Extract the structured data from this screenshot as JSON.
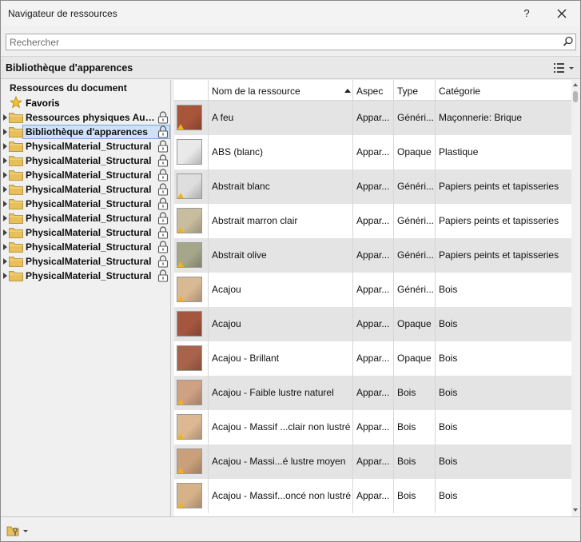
{
  "window": {
    "title": "Navigateur de ressources",
    "help_label": "?"
  },
  "search": {
    "placeholder": "Rechercher",
    "value": ""
  },
  "library_bar": {
    "title": "Bibliothèque d'apparences"
  },
  "tree": {
    "header": "Ressources du document",
    "favorites": "Favoris",
    "items": [
      {
        "label": "Ressources physiques Autodesk",
        "selected": false
      },
      {
        "label": "Bibliothèque d'apparences",
        "selected": true
      },
      {
        "label": "PhysicalMaterial_Structural",
        "selected": false
      },
      {
        "label": "PhysicalMaterial_Structural",
        "selected": false
      },
      {
        "label": "PhysicalMaterial_Structural",
        "selected": false
      },
      {
        "label": "PhysicalMaterial_Structural",
        "selected": false
      },
      {
        "label": "PhysicalMaterial_Structural",
        "selected": false
      },
      {
        "label": "PhysicalMaterial_Structural",
        "selected": false
      },
      {
        "label": "PhysicalMaterial_Structural",
        "selected": false
      },
      {
        "label": "PhysicalMaterial_Structural",
        "selected": false
      },
      {
        "label": "PhysicalMaterial_Structural",
        "selected": false
      },
      {
        "label": "PhysicalMaterial_Structural",
        "selected": false
      }
    ]
  },
  "table": {
    "columns": [
      "Nom de la ressource",
      "Aspec",
      "Type",
      "Catégorie"
    ],
    "rows": [
      {
        "name": "A feu",
        "aspect": "Appar...",
        "type": "Généri...",
        "category": "Maçonnerie: Brique",
        "color": "#a8553a",
        "warn": true
      },
      {
        "name": "ABS (blanc)",
        "aspect": "Appar...",
        "type": "Opaque",
        "category": "Plastique",
        "color": "#e9e9e9",
        "warn": false
      },
      {
        "name": "Abstrait blanc",
        "aspect": "Appar...",
        "type": "Généri...",
        "category": "Papiers peints et tapisseries",
        "color": "#dedede",
        "warn": true
      },
      {
        "name": "Abstrait marron clair",
        "aspect": "Appar...",
        "type": "Généri...",
        "category": "Papiers peints et tapisseries",
        "color": "#c9bd9f",
        "warn": true
      },
      {
        "name": "Abstrait olive",
        "aspect": "Appar...",
        "type": "Généri...",
        "category": "Papiers peints et tapisseries",
        "color": "#a6a68b",
        "warn": true
      },
      {
        "name": "Acajou",
        "aspect": "Appar...",
        "type": "Généri...",
        "category": "Bois",
        "color": "#d9b894",
        "warn": true
      },
      {
        "name": "Acajou",
        "aspect": "Appar...",
        "type": "Opaque",
        "category": "Bois",
        "color": "#a4573e",
        "warn": false
      },
      {
        "name": "Acajou - Brillant",
        "aspect": "Appar...",
        "type": "Opaque",
        "category": "Bois",
        "color": "#a9634a",
        "warn": false
      },
      {
        "name": "Acajou - Faible lustre naturel",
        "aspect": "Appar...",
        "type": "Bois",
        "category": "Bois",
        "color": "#cfa183",
        "warn": true
      },
      {
        "name": "Acajou - Massif ...clair non lustré",
        "aspect": "Appar...",
        "type": "Bois",
        "category": "Bois",
        "color": "#dcb993",
        "warn": true
      },
      {
        "name": "Acajou - Massi...é lustre moyen",
        "aspect": "Appar...",
        "type": "Bois",
        "category": "Bois",
        "color": "#caa07b",
        "warn": true
      },
      {
        "name": "Acajou - Massif...oncé non lustré",
        "aspect": "Appar...",
        "type": "Bois",
        "category": "Bois",
        "color": "#d5b288",
        "warn": true
      }
    ]
  },
  "icons": {
    "search": "search-icon",
    "close": "close-icon",
    "view": "list-view-icon",
    "star": "star-icon",
    "folder": "folder-icon",
    "lock": "lock-icon",
    "warning": "warning-icon",
    "library_tool": "library-tool-icon"
  },
  "colors": {
    "selection": "#cfe1f6",
    "warning": "#f3b21a",
    "folder": "#e8c05a"
  }
}
